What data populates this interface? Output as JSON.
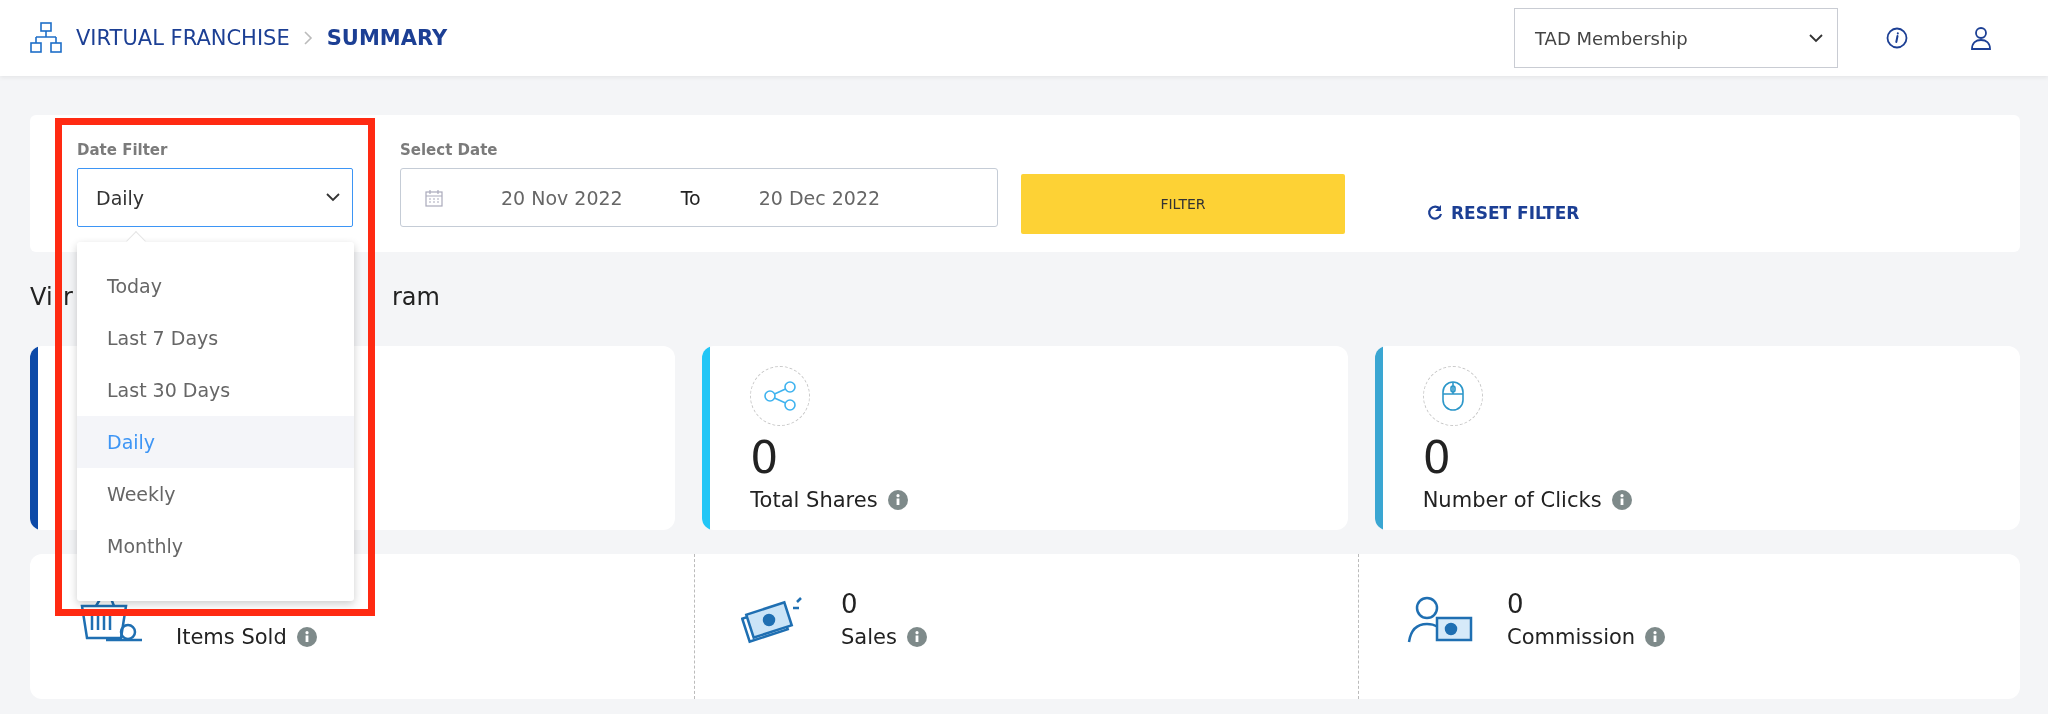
{
  "header": {
    "breadcrumb": [
      {
        "label": "VIRTUAL FRANCHISE",
        "current": false
      },
      {
        "label": "SUMMARY",
        "current": true
      }
    ],
    "program_select": {
      "value": "TAD Membership"
    }
  },
  "filters": {
    "date_filter": {
      "label": "Date Filter",
      "value": "Daily",
      "expanded": true,
      "options": [
        {
          "label": "Today",
          "selected": false
        },
        {
          "label": "Last 7 Days",
          "selected": false
        },
        {
          "label": "Last 30 Days",
          "selected": false
        },
        {
          "label": "Daily",
          "selected": true
        },
        {
          "label": "Weekly",
          "selected": false
        },
        {
          "label": "Monthly",
          "selected": false
        }
      ]
    },
    "select_date": {
      "label": "Select Date",
      "from": "20 Nov 2022",
      "to_label": "To",
      "to": "20 Dec 2022"
    },
    "filter_button": "FILTER",
    "reset_button": "RESET FILTER"
  },
  "section_title": {
    "parts": [
      "Vi",
      "r",
      "ram"
    ]
  },
  "stat_cards": [
    {
      "kind": "covered",
      "color": "#0d4aa8"
    },
    {
      "kind": "shares",
      "color": "#22c6f6",
      "value": "0",
      "label": "Total Shares"
    },
    {
      "kind": "clicks",
      "color": "#3aa6d2",
      "value": "0",
      "label": "Number of Clicks"
    }
  ],
  "summary": [
    {
      "kind": "items",
      "label": "Items Sold"
    },
    {
      "kind": "sales",
      "value": "0",
      "label": "Sales"
    },
    {
      "kind": "commission",
      "value": "0",
      "label": "Commission"
    }
  ],
  "annotation": {
    "kind": "frame"
  }
}
